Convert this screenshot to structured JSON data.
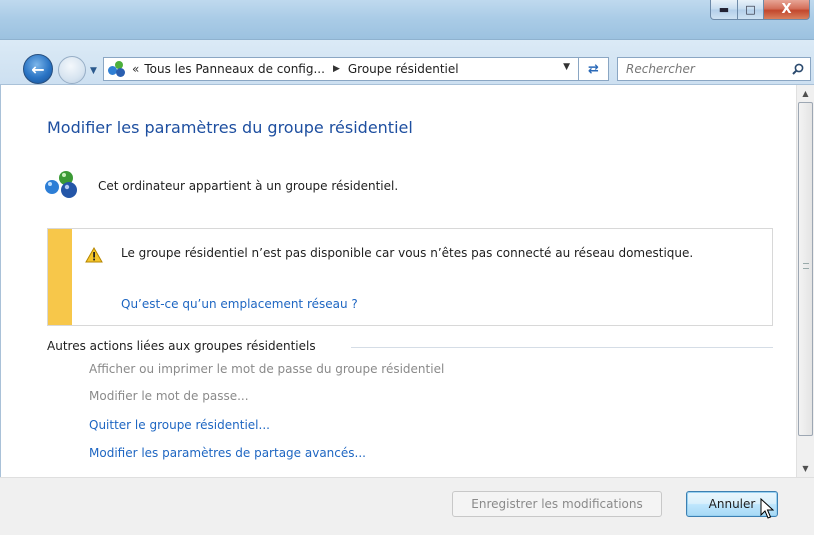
{
  "window": {
    "minimize_icon": "minimize-icon",
    "maximize_icon": "maximize-icon",
    "close_icon": "close-icon",
    "close_glyph": "X"
  },
  "navigation": {
    "breadcrumb_prefix": "«",
    "breadcrumb": [
      "Tous les Panneaux de config...",
      "Groupe résidentiel"
    ],
    "search_placeholder": "Rechercher"
  },
  "main": {
    "title": "Modifier les paramètres du groupe résidentiel",
    "membership_text": "Cet ordinateur appartient à un groupe résidentiel.",
    "warning": {
      "text": "Le groupe résidentiel n’est pas disponible car vous n’êtes pas connecté au réseau domestique.",
      "link": "Qu’est-ce qu’un emplacement réseau ?",
      "stripe_color": "#f7c74a"
    },
    "other_actions": {
      "header": "Autres actions liées aux groupes résidentiels",
      "items": [
        {
          "label": "Afficher ou imprimer le mot de passe du groupe résidentiel",
          "enabled": false
        },
        {
          "label": "Modifier le mot de passe...",
          "enabled": false
        },
        {
          "label": "Quitter le groupe résidentiel...",
          "enabled": true
        },
        {
          "label": "Modifier les paramètres de partage avancés...",
          "enabled": true
        }
      ]
    }
  },
  "footer": {
    "save_label": "Enregistrer les modifications",
    "cancel_label": "Annuler"
  },
  "colors": {
    "link": "#1e66c2",
    "title": "#1e4fa0",
    "disabled": "#8a8a8a"
  }
}
